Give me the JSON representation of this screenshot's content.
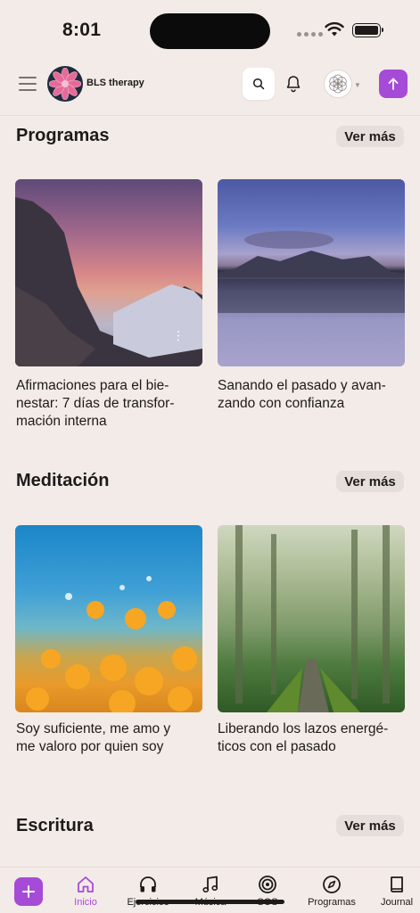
{
  "status_bar": {
    "time": "8:01"
  },
  "header": {
    "brand_name": "BLS therapy"
  },
  "sections": [
    {
      "title": "Programas",
      "see_more": "Ver más",
      "cards": [
        {
          "caption": "Afirmaciones para el bie-\nnestar: 7 días de transfor-\nmación interna"
        },
        {
          "caption": "Sanando el pasado y avan-\nzando con confianza"
        }
      ]
    },
    {
      "title": "Meditación",
      "see_more": "Ver más",
      "cards": [
        {
          "caption": "Soy suficiente, me amo y\nme valoro por quien soy"
        },
        {
          "caption": "Liberando los lazos energé-\nticos con el pasado"
        }
      ]
    },
    {
      "title": "Escritura",
      "see_more": "Ver más"
    }
  ],
  "bottom_nav": {
    "items": [
      {
        "label": "Inicio",
        "icon": "home-icon",
        "active": true
      },
      {
        "label": "Ejercicios",
        "icon": "headphones-icon"
      },
      {
        "label": "Música",
        "icon": "music-note-icon"
      },
      {
        "label": "SOS",
        "icon": "target-icon"
      },
      {
        "label": "Programas",
        "icon": "compass-icon"
      },
      {
        "label": "Journal",
        "icon": "book-icon"
      }
    ]
  },
  "colors": {
    "accent": "#a64ad8",
    "background": "#f3ebe7"
  }
}
